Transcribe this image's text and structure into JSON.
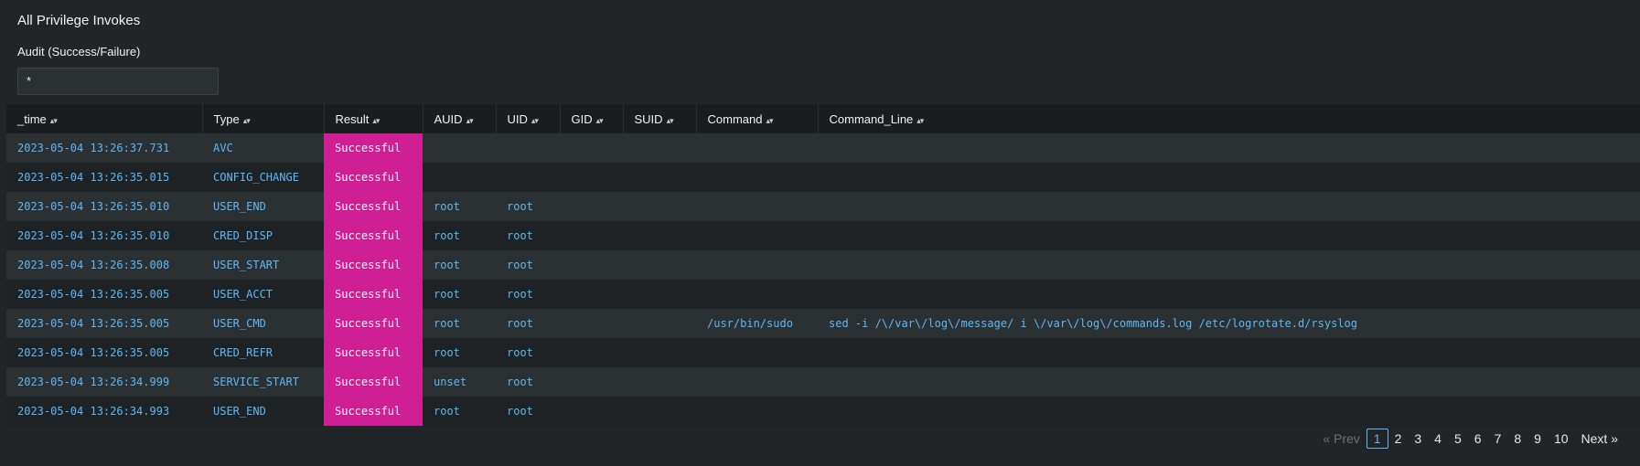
{
  "panel": {
    "title": "All Privilege Invokes",
    "input_label": "Audit (Success/Failure)",
    "input_value": "*"
  },
  "table": {
    "columns": [
      "_time",
      "Type",
      "Result",
      "AUID",
      "UID",
      "GID",
      "SUID",
      "Command",
      "Command_Line"
    ],
    "rows": [
      [
        "2023-05-04 13:26:37.731",
        "AVC",
        "Successful",
        "",
        "",
        "",
        "",
        "",
        ""
      ],
      [
        "2023-05-04 13:26:35.015",
        "CONFIG_CHANGE",
        "Successful",
        "",
        "",
        "",
        "",
        "",
        ""
      ],
      [
        "2023-05-04 13:26:35.010",
        "USER_END",
        "Successful",
        "root",
        "root",
        "",
        "",
        "",
        ""
      ],
      [
        "2023-05-04 13:26:35.010",
        "CRED_DISP",
        "Successful",
        "root",
        "root",
        "",
        "",
        "",
        ""
      ],
      [
        "2023-05-04 13:26:35.008",
        "USER_START",
        "Successful",
        "root",
        "root",
        "",
        "",
        "",
        ""
      ],
      [
        "2023-05-04 13:26:35.005",
        "USER_ACCT",
        "Successful",
        "root",
        "root",
        "",
        "",
        "",
        ""
      ],
      [
        "2023-05-04 13:26:35.005",
        "USER_CMD",
        "Successful",
        "root",
        "root",
        "",
        "",
        "/usr/bin/sudo",
        "sed -i /\\/var\\/log\\/message/ i \\/var\\/log\\/commands.log /etc/logrotate.d/rsyslog"
      ],
      [
        "2023-05-04 13:26:35.005",
        "CRED_REFR",
        "Successful",
        "root",
        "root",
        "",
        "",
        "",
        ""
      ],
      [
        "2023-05-04 13:26:34.999",
        "SERVICE_START",
        "Successful",
        "unset",
        "root",
        "",
        "",
        "",
        ""
      ],
      [
        "2023-05-04 13:26:34.993",
        "USER_END",
        "Successful",
        "root",
        "root",
        "",
        "",
        "",
        ""
      ]
    ]
  },
  "pager": {
    "prev": "« Prev",
    "pages": [
      "1",
      "2",
      "3",
      "4",
      "5",
      "6",
      "7",
      "8",
      "9",
      "10"
    ],
    "active": "1",
    "next": "Next »"
  },
  "colors": {
    "result_highlight": "#d01f95",
    "link": "#5db8f5",
    "background": "#212527"
  }
}
